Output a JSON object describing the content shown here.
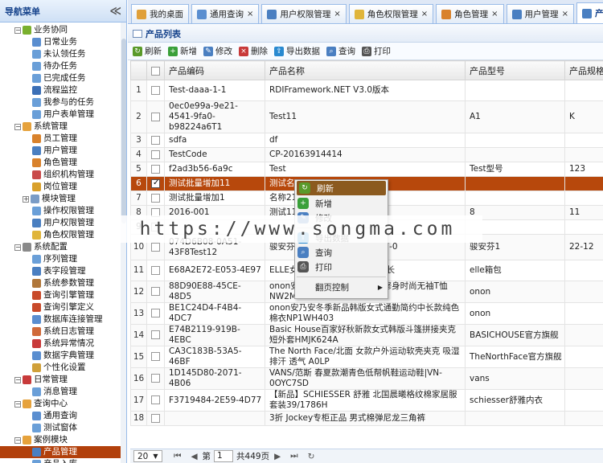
{
  "sidebar": {
    "title": "导航菜单",
    "collapse": "≪",
    "tree": [
      {
        "label": "业务协同",
        "level": 0,
        "toggle": "−",
        "color": "#7ab02e"
      },
      {
        "label": "日常业务",
        "level": 2,
        "color": "#5a8ed0"
      },
      {
        "label": "未认领任务",
        "level": 2,
        "color": "#6a9fd8"
      },
      {
        "label": "待办任务",
        "level": 2,
        "color": "#6a9fd8"
      },
      {
        "label": "已完成任务",
        "level": 2,
        "color": "#6a9fd8"
      },
      {
        "label": "流程监控",
        "level": 2,
        "color": "#3b6fb6"
      },
      {
        "label": "我参与的任务",
        "level": 2,
        "color": "#6a9fd8"
      },
      {
        "label": "用户表单管理",
        "level": 2,
        "color": "#6a9fd8"
      },
      {
        "label": "系统管理",
        "level": 0,
        "toggle": "−",
        "color": "#e6a23c"
      },
      {
        "label": "员工管理",
        "level": 2,
        "color": "#d9822b"
      },
      {
        "label": "用户管理",
        "level": 2,
        "color": "#4a7fc1"
      },
      {
        "label": "角色管理",
        "level": 2,
        "color": "#d9822b"
      },
      {
        "label": "组织机构管理",
        "level": 2,
        "color": "#c94a4a"
      },
      {
        "label": "岗位管理",
        "level": 2,
        "color": "#d9a02b"
      },
      {
        "label": "模块管理",
        "level": 1,
        "toggle": "+",
        "color": "#7a9cc6"
      },
      {
        "label": "操作权限管理",
        "level": 2,
        "color": "#6a9fd8"
      },
      {
        "label": "用户权限管理",
        "level": 2,
        "color": "#4a7fc1"
      },
      {
        "label": "角色权限管理",
        "level": 2,
        "color": "#e0b53a"
      },
      {
        "label": "系统配置",
        "level": 0,
        "toggle": "−",
        "color": "#8a8a8a"
      },
      {
        "label": "序列管理",
        "level": 2,
        "color": "#6a9fd8"
      },
      {
        "label": "表字段管理",
        "level": 2,
        "color": "#4a7fc1"
      },
      {
        "label": "系统参数管理",
        "level": 2,
        "color": "#b0773a"
      },
      {
        "label": "查询引擎管理",
        "level": 2,
        "color": "#c84a2a"
      },
      {
        "label": "查询引擎定义",
        "level": 2,
        "color": "#c84a2a"
      },
      {
        "label": "数据库连接管理",
        "level": 2,
        "color": "#5a8ed0"
      },
      {
        "label": "系统日志管理",
        "level": 2,
        "color": "#d06a3a"
      },
      {
        "label": "系统异常情况",
        "level": 2,
        "color": "#c83a3a"
      },
      {
        "label": "数据字典管理",
        "level": 2,
        "color": "#5a8ed0"
      },
      {
        "label": "个性化设置",
        "level": 2,
        "color": "#d0a03a"
      },
      {
        "label": "日常管理",
        "level": 0,
        "toggle": "−",
        "color": "#c83a3a"
      },
      {
        "label": "消息管理",
        "level": 2,
        "color": "#6a9fd8"
      },
      {
        "label": "查询中心",
        "level": 0,
        "toggle": "−",
        "color": "#e6a23c"
      },
      {
        "label": "通用查询",
        "level": 2,
        "color": "#5a8ed0"
      },
      {
        "label": "测试窗体",
        "level": 2,
        "color": "#6a9fd8"
      },
      {
        "label": "案例模块",
        "level": 0,
        "toggle": "−",
        "color": "#e6a23c"
      },
      {
        "label": "产品管理",
        "level": 2,
        "color": "#4a7fc1",
        "selected": true
      },
      {
        "label": "产品入库",
        "level": 2,
        "color": "#6a9fd8"
      }
    ]
  },
  "tabs": [
    {
      "label": "我的桌面",
      "color": "#e0a03a",
      "closable": false
    },
    {
      "label": "通用查询",
      "color": "#5a8ed0",
      "closable": true
    },
    {
      "label": "用户权限管理",
      "color": "#4a7fc1",
      "closable": true
    },
    {
      "label": "角色权限管理",
      "color": "#e0b53a",
      "closable": true
    },
    {
      "label": "角色管理",
      "color": "#d9822b",
      "closable": true
    },
    {
      "label": "用户管理",
      "color": "#4a7fc1",
      "closable": true
    },
    {
      "label": "产品管理",
      "color": "#4a7fc1",
      "closable": false,
      "active": true
    }
  ],
  "panel": {
    "title": "产品列表"
  },
  "toolbar": [
    {
      "label": "刷新",
      "name": "refresh",
      "color": "#5a9a2a",
      "glyph": "↻"
    },
    {
      "label": "新增",
      "name": "add",
      "color": "#3aa03a",
      "glyph": "+"
    },
    {
      "label": "修改",
      "name": "edit",
      "color": "#4a7fc1",
      "glyph": "✎"
    },
    {
      "label": "删除",
      "name": "delete",
      "color": "#c83a3a",
      "glyph": "×"
    },
    {
      "label": "导出数据",
      "name": "export",
      "color": "#2a8ad0",
      "glyph": "⇪"
    },
    {
      "label": "查询",
      "name": "query",
      "color": "#4a7fc1",
      "glyph": "⌕"
    },
    {
      "label": "打印",
      "name": "print",
      "color": "#555555",
      "glyph": "⎙"
    }
  ],
  "grid": {
    "columns": [
      "产品编码",
      "产品名称",
      "产品型号",
      "产品规格"
    ],
    "rows": [
      {
        "n": "1",
        "code": "Test-daaa-1-1",
        "name": "RDIFramework.NET V3.0版本",
        "model": "",
        "spec": ""
      },
      {
        "n": "2",
        "code": "0ec0e99a-9e21-4541-9fa0-b98224a6T1",
        "name": "Test11",
        "model": "A1",
        "spec": "K"
      },
      {
        "n": "3",
        "code": "sdfa",
        "name": "df",
        "model": "",
        "spec": ""
      },
      {
        "n": "4",
        "code": "TestCode",
        "name": "CP-20163914414",
        "model": "",
        "spec": ""
      },
      {
        "n": "5",
        "code": "f2ad3b56-6a9c",
        "name": "Test",
        "model": "Test型号",
        "spec": "123"
      },
      {
        "n": "6",
        "code": "测试批量增加11",
        "name": "测试名",
        "model": "",
        "spec": "",
        "selected": true
      },
      {
        "n": "7",
        "code": "测试批量增加1",
        "name": "名称21",
        "model": "",
        "spec": ""
      },
      {
        "n": "8",
        "code": "2016-001",
        "name": "测试11",
        "model": "8",
        "spec": "11"
      },
      {
        "n": "9",
        "code": "",
        "name": "",
        "model": "",
        "spec": ""
      },
      {
        "n": "10",
        "code": "074D6B08-0A51-43F8Test12",
        "name": "骏安芬 边3/4幕杯彩线文胸 B17-0",
        "model": "骏安芬1",
        "spec": "22-12"
      },
      {
        "n": "11",
        "code": "E68A2E72-E053-4E97",
        "name": "ELLE女 PVC29140韩版钱包女长",
        "model": "elle箱包",
        "spec": ""
      },
      {
        "n": "12",
        "code": "88D90E88-45CE-48D5",
        "name": "onon安乃安冬装新品韩版显瘦修身时尚无袖T恤NW2ME630",
        "model": "onon",
        "spec": ""
      },
      {
        "n": "13",
        "code": "BE1C24D4-F4B4-4DC7",
        "name": "onon安乃安冬季新品韩版女式通勤简约中长款纯色棉衣NP1WH403",
        "model": "onon",
        "spec": ""
      },
      {
        "n": "14",
        "code": "E74B2119-919B-4EBC",
        "name": "Basic House百家好秋新款女式韩版斗篷拼接夹克短外套HMJK624A",
        "model": "BASICHOUSE官方旗舰",
        "spec": ""
      },
      {
        "n": "15",
        "code": "CA3C183B-53A5-46BF",
        "name": "The North Face/北面 女款户外运动软壳夹克 吸湿排汗 透气 A0LP",
        "model": "TheNorthFace官方旗舰",
        "spec": ""
      },
      {
        "n": "16",
        "code": "1D145D80-2071-4B06",
        "name": "VANS/范斯 春夏款潮青色低帮帆鞋运动鞋|VN-0OYC7SD",
        "model": "vans",
        "spec": ""
      },
      {
        "n": "17",
        "code": "F3719484-2E59-4D77",
        "name": "【新品】SCHIESSER 舒雅 北国晨曦格纹棉家居服套装39/1786H",
        "model": "schiesser舒雅内衣",
        "spec": ""
      },
      {
        "n": "18",
        "code": "",
        "name": "3折 Jockey专柜正品 男式棉弹尼龙三角裤",
        "model": "",
        "spec": ""
      }
    ]
  },
  "context_menu": [
    {
      "label": "刷新",
      "color": "#5a9a2a",
      "glyph": "↻",
      "highlight": true
    },
    {
      "label": "新增",
      "color": "#3aa03a",
      "glyph": "+"
    },
    {
      "label": "修改",
      "color": "#4a7fc1",
      "glyph": "✎"
    },
    {
      "sep": true
    },
    {
      "label": "导出数据",
      "color": "#2a8ad0",
      "glyph": "⇪"
    },
    {
      "label": "查询",
      "color": "#4a7fc1",
      "glyph": "⌕"
    },
    {
      "label": "打印",
      "color": "#555555",
      "glyph": "⎙"
    },
    {
      "sep": true
    },
    {
      "label": "翻页控制",
      "color": "",
      "glyph": "",
      "submenu": true
    }
  ],
  "watermark": "https://www.songma.com",
  "pager": {
    "page_size": "20",
    "page_label": "第",
    "page_value": "1",
    "total": "共449页"
  }
}
